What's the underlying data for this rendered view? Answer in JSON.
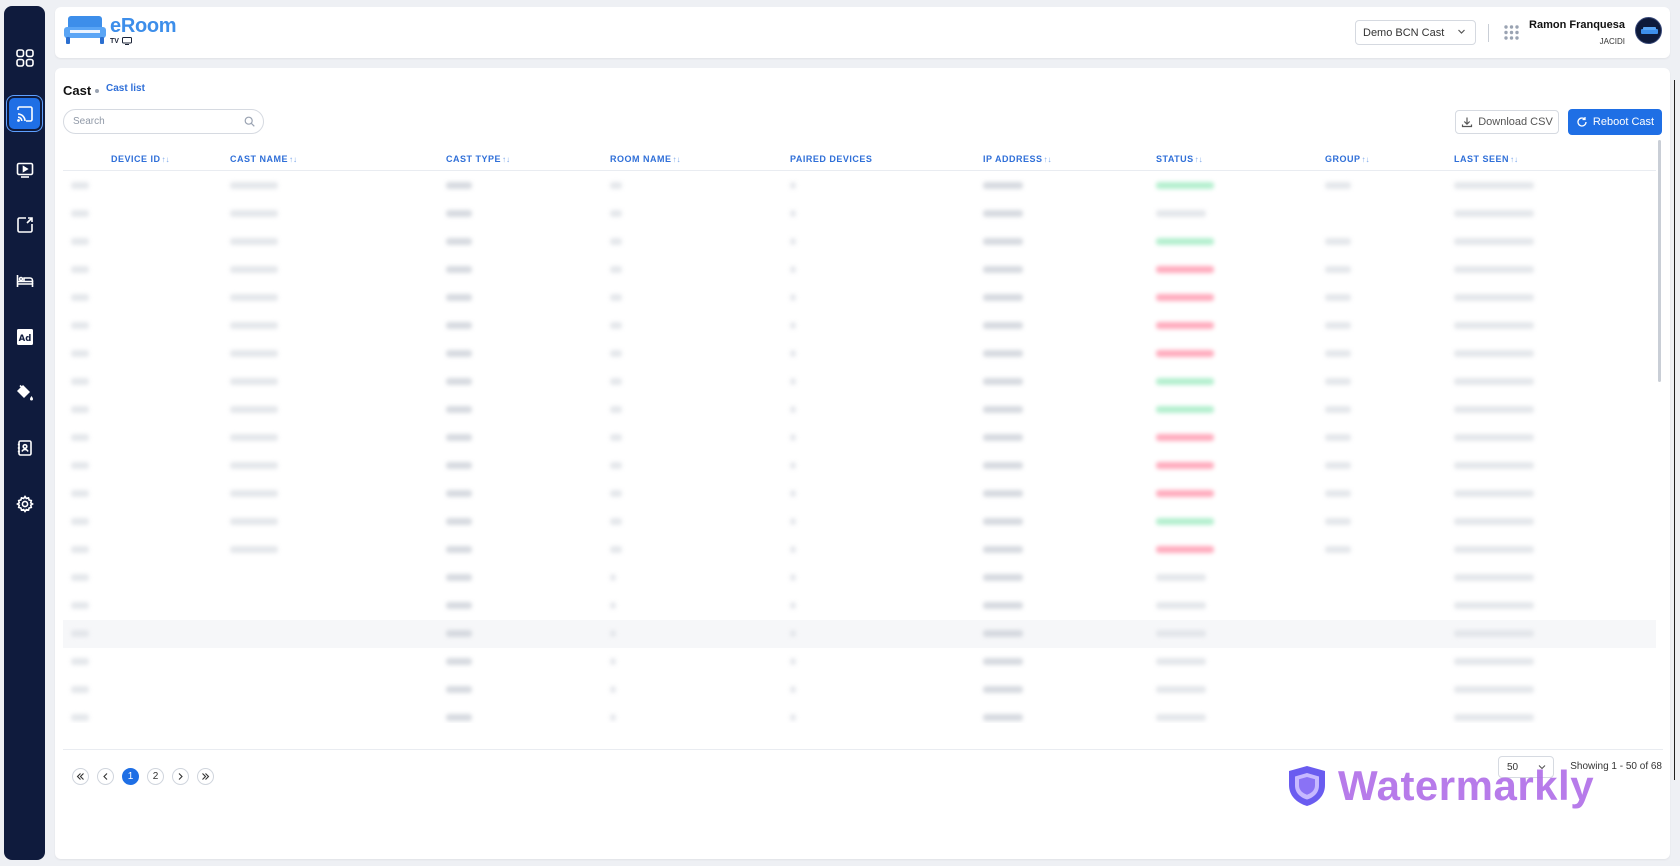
{
  "sidebar": {
    "items": [
      {
        "name": "dashboard",
        "icon": "grid-icon",
        "active": false
      },
      {
        "name": "cast",
        "icon": "cast-icon",
        "active": true
      },
      {
        "name": "media",
        "icon": "play-screen-icon",
        "active": false
      },
      {
        "name": "screens",
        "icon": "screen-share-icon",
        "active": false
      },
      {
        "name": "rooms",
        "icon": "bed-icon",
        "active": false
      },
      {
        "name": "ads",
        "icon": "ad-icon",
        "active": false
      },
      {
        "name": "theme",
        "icon": "paint-bucket-icon",
        "active": false
      },
      {
        "name": "contacts",
        "icon": "contact-card-icon",
        "active": false
      },
      {
        "name": "settings",
        "icon": "gear-icon",
        "active": false
      }
    ]
  },
  "header": {
    "logo_name": "eRoom",
    "logo_sub": "TV",
    "project": "Demo BCN Cast",
    "user_name": "Ramon Franquesa",
    "user_org": "JACIDI"
  },
  "page": {
    "title": "Cast",
    "breadcrumb": "Cast list",
    "search_placeholder": "Search",
    "download_label": "Download CSV",
    "reboot_label": "Reboot Cast"
  },
  "table": {
    "columns": [
      "DEVICE ID",
      "CAST NAME",
      "CAST TYPE",
      "ROOM NAME",
      "PAIRED DEVICES",
      "IP ADDRESS",
      "STATUS",
      "GROUP",
      "LAST SEEN"
    ],
    "sortable": [
      true,
      true,
      true,
      true,
      false,
      true,
      true,
      true,
      true
    ],
    "rows": [
      {
        "status": "online"
      },
      {
        "status": "none"
      },
      {
        "status": "online"
      },
      {
        "status": "offline"
      },
      {
        "status": "offline"
      },
      {
        "status": "offline"
      },
      {
        "status": "offline"
      },
      {
        "status": "online"
      },
      {
        "status": "online"
      },
      {
        "status": "offline"
      },
      {
        "status": "offline"
      },
      {
        "status": "offline"
      },
      {
        "status": "online"
      },
      {
        "status": "offline"
      },
      {
        "status": "none"
      },
      {
        "status": "none"
      },
      {
        "status": "none"
      },
      {
        "status": "none"
      },
      {
        "status": "none"
      },
      {
        "status": "none"
      }
    ],
    "highlighted_row": 16
  },
  "pagination": {
    "pages": [
      "1",
      "2"
    ],
    "current": "1",
    "per_page": "50",
    "showing": "Showing 1 - 50 of 68"
  },
  "watermark": "Watermarkly",
  "colors": {
    "sidebar_bg": "#0f1b3d",
    "accent": "#1f6fe5",
    "link": "#2f6fd8",
    "online": "#a6ecc6",
    "offline": "#ff9cb1"
  }
}
